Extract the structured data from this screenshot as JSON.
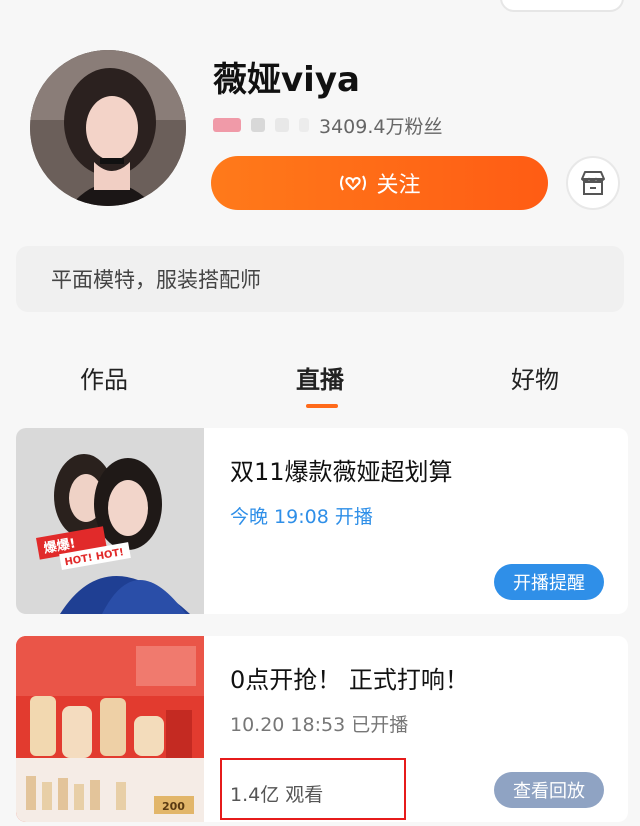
{
  "profile": {
    "name": "薇娅viya",
    "fans_count": "3409.4万粉丝",
    "follow_label": "关注",
    "bio": "平面模特，服装搭配师"
  },
  "tabs": [
    {
      "label": "作品"
    },
    {
      "label": "直播"
    },
    {
      "label": "好物"
    }
  ],
  "active_tab": "直播",
  "accent_color": "#ff6a1a",
  "live_cards": [
    {
      "title": "双11爆款薇娅超划算",
      "subtitle": "今晚 19:08 开播",
      "button_label": "开播提醒",
      "thumb_badge": "爆爆!",
      "thumb_badge_sub": "HOT! HOT!"
    },
    {
      "title": "0点开抢！ 正式打响！",
      "subtitle": "10.20 18:53 已开播",
      "views": "1.4亿 观看",
      "button_label": "查看回放",
      "thumb_price_tag": "200"
    }
  ],
  "icons": {
    "follow": "live-heart-icon",
    "shop": "store-icon"
  }
}
